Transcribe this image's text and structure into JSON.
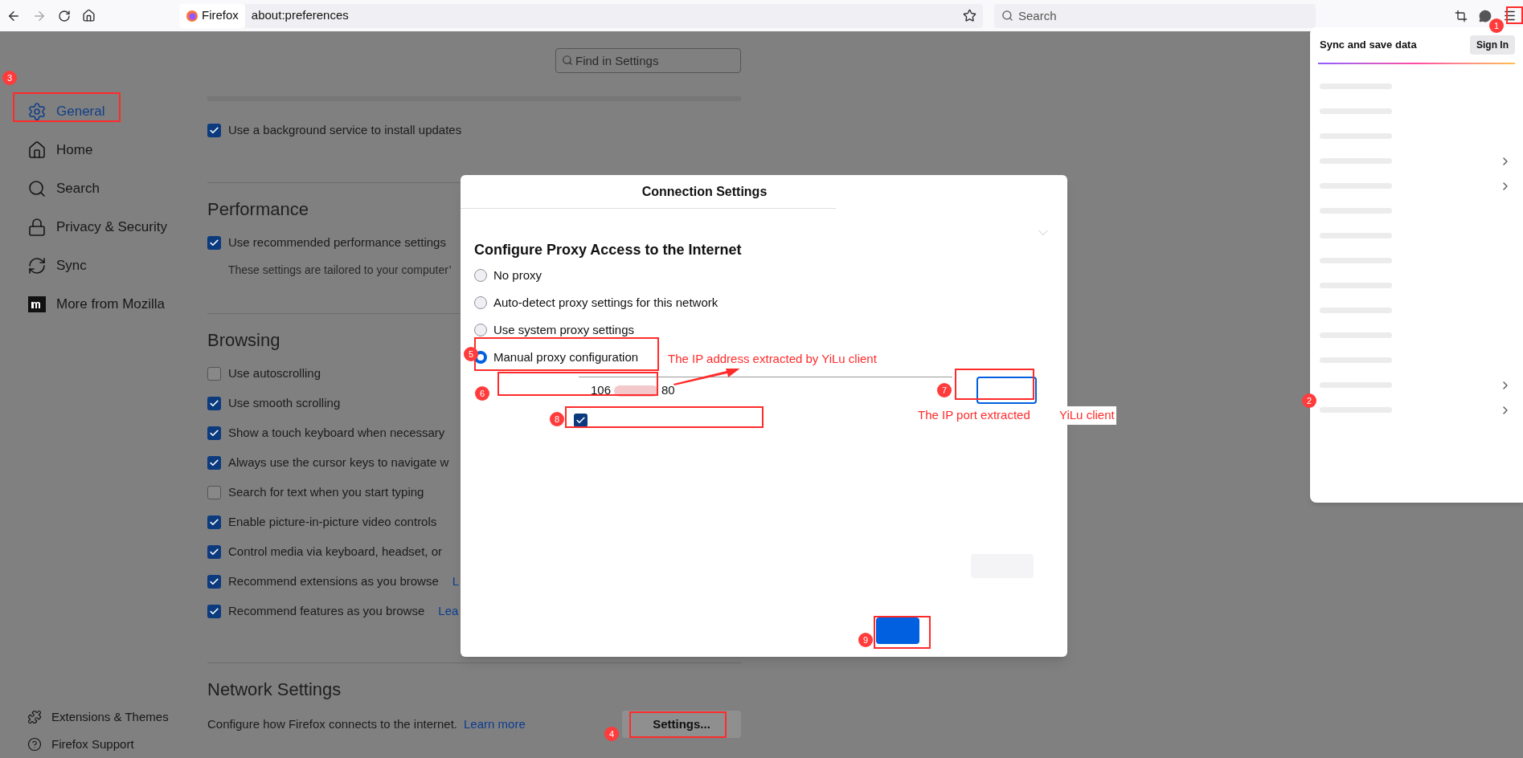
{
  "toolbar": {
    "identity": "Firefox",
    "url": "about:preferences",
    "search": {
      "placeholder": "Search"
    }
  },
  "sidebar": {
    "items": [
      {
        "label": "General",
        "selected": true
      },
      {
        "label": "Home",
        "selected": false
      },
      {
        "label": "Search",
        "selected": false
      },
      {
        "label": "Privacy & Security",
        "selected": false
      },
      {
        "label": "Sync",
        "selected": false
      },
      {
        "label": "More from Mozilla",
        "selected": false
      }
    ],
    "footer": [
      "Extensions & Themes",
      "Firefox Support"
    ]
  },
  "settings": {
    "search": {
      "placeholder": "Find in Settings"
    },
    "sections": [
      {
        "rows": [
          {
            "kind": "checkbox",
            "label": "Use a background service to install updates",
            "checked": true
          }
        ]
      },
      {
        "title": "Performance",
        "rows": [
          {
            "kind": "checkbox",
            "label": "Use recommended performance settings",
            "checked": true
          },
          {
            "kind": "note",
            "label": "These settings are tailored to your computer’"
          }
        ]
      },
      {
        "title": "Browsing",
        "rows": [
          {
            "kind": "checkbox",
            "label": "Use autoscrolling",
            "checked": false
          },
          {
            "kind": "checkbox",
            "label": "Use smooth scrolling",
            "checked": true
          },
          {
            "kind": "checkbox",
            "label": "Show a touch keyboard when necessary",
            "checked": true
          },
          {
            "kind": "checkbox",
            "label": "Always use the cursor keys to navigate w",
            "checked": true
          },
          {
            "kind": "checkbox",
            "label": "Search for text when you start typing",
            "checked": false
          },
          {
            "kind": "checkbox",
            "label": "Enable picture-in-picture video controls",
            "checked": true
          },
          {
            "kind": "checkbox",
            "label": "Control media via keyboard, headset, or",
            "checked": true
          },
          {
            "kind": "checkbox",
            "label": "Recommend extensions as you browse",
            "checked": true,
            "link": "L"
          },
          {
            "kind": "checkbox",
            "label": "Recommend features as you browse",
            "checked": true,
            "link": "Lea"
          }
        ]
      },
      {
        "title": "Network Settings",
        "rows": [
          {
            "kind": "action",
            "label": "Configure how Firefox connects to the internet.",
            "link": "Learn more",
            "button": "Settings..."
          }
        ]
      }
    ]
  },
  "dialog": {
    "title": "Connection Settings",
    "heading": "Configure Proxy Access to the Internet",
    "options": [
      {
        "label": "No proxy",
        "selected": false
      },
      {
        "label": "Auto-detect proxy settings for this network",
        "selected": false
      },
      {
        "label": "Use system proxy settings",
        "selected": false
      },
      {
        "label": "Manual proxy configuration",
        "selected": true
      }
    ],
    "http_proxy": {
      "value_start": "106",
      "value_end": "80"
    },
    "also_https": {
      "checked": true
    }
  },
  "menu": {
    "header": "Sync and save data",
    "sign_in": "Sign In",
    "rows": [
      {
        "submenu": false
      },
      {
        "submenu": false
      },
      {
        "submenu": false
      },
      {
        "submenu": true
      },
      {
        "submenu": true
      },
      {
        "submenu": false
      },
      {
        "submenu": false
      },
      {
        "submenu": false
      },
      {
        "submenu": false
      },
      {
        "submenu": false
      },
      {
        "submenu": false
      },
      {
        "submenu": false
      },
      {
        "submenu": true
      },
      {
        "submenu": true
      }
    ]
  },
  "annotations": {
    "markers": [
      "1",
      "2",
      "3",
      "4",
      "5",
      "6",
      "7",
      "8",
      "9"
    ],
    "notes": [
      "The IP address extracted by YiLu client",
      "The IP port extracted",
      "YiLu client"
    ]
  }
}
